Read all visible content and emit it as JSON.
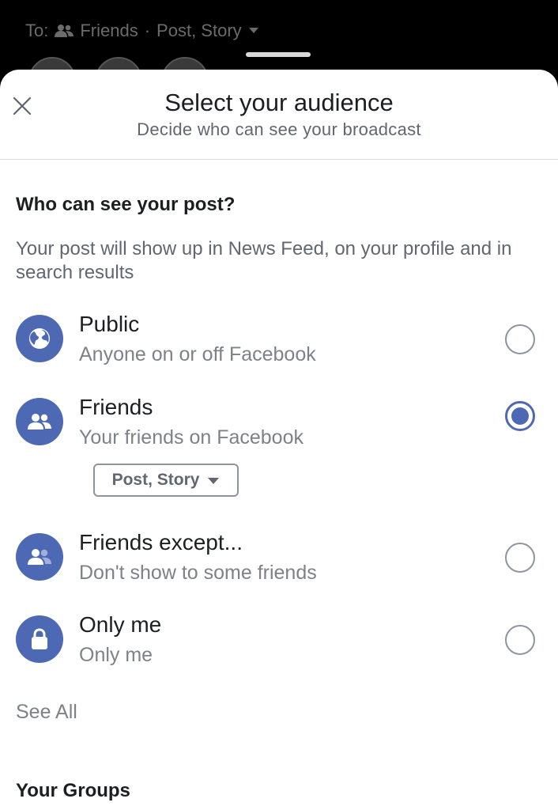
{
  "composer": {
    "to_label": "To:",
    "audience_label": "Friends",
    "separator": "·",
    "destinations": "Post, Story",
    "icons": {
      "audience": "friends-icon",
      "dropdown": "caret-down-icon"
    }
  },
  "sheet": {
    "title": "Select your audience",
    "subtitle": "Decide who can see your broadcast",
    "close_icon": "close-icon"
  },
  "post_section": {
    "heading": "Who can see your post?",
    "description": "Your post will show up in News Feed, on your profile and in search results"
  },
  "options": [
    {
      "title": "Public",
      "subtitle": "Anyone on or off Facebook",
      "icon": "globe-icon",
      "selected": false
    },
    {
      "title": "Friends",
      "subtitle": "Your friends on Facebook",
      "icon": "friends-icon",
      "selected": true
    },
    {
      "title": "Friends except...",
      "subtitle": "Don't show to some friends",
      "icon": "friends-except-icon",
      "selected": false
    },
    {
      "title": "Only me",
      "subtitle": "Only me",
      "icon": "lock-icon",
      "selected": false
    }
  ],
  "friends_destinations_pill": "Post, Story",
  "see_all": "See All",
  "groups_heading": "Your Groups",
  "colors": {
    "accent": "#4e69b3",
    "text_primary": "#1c1e21",
    "text_secondary": "#7d8288",
    "radio_border": "#8d949e"
  }
}
